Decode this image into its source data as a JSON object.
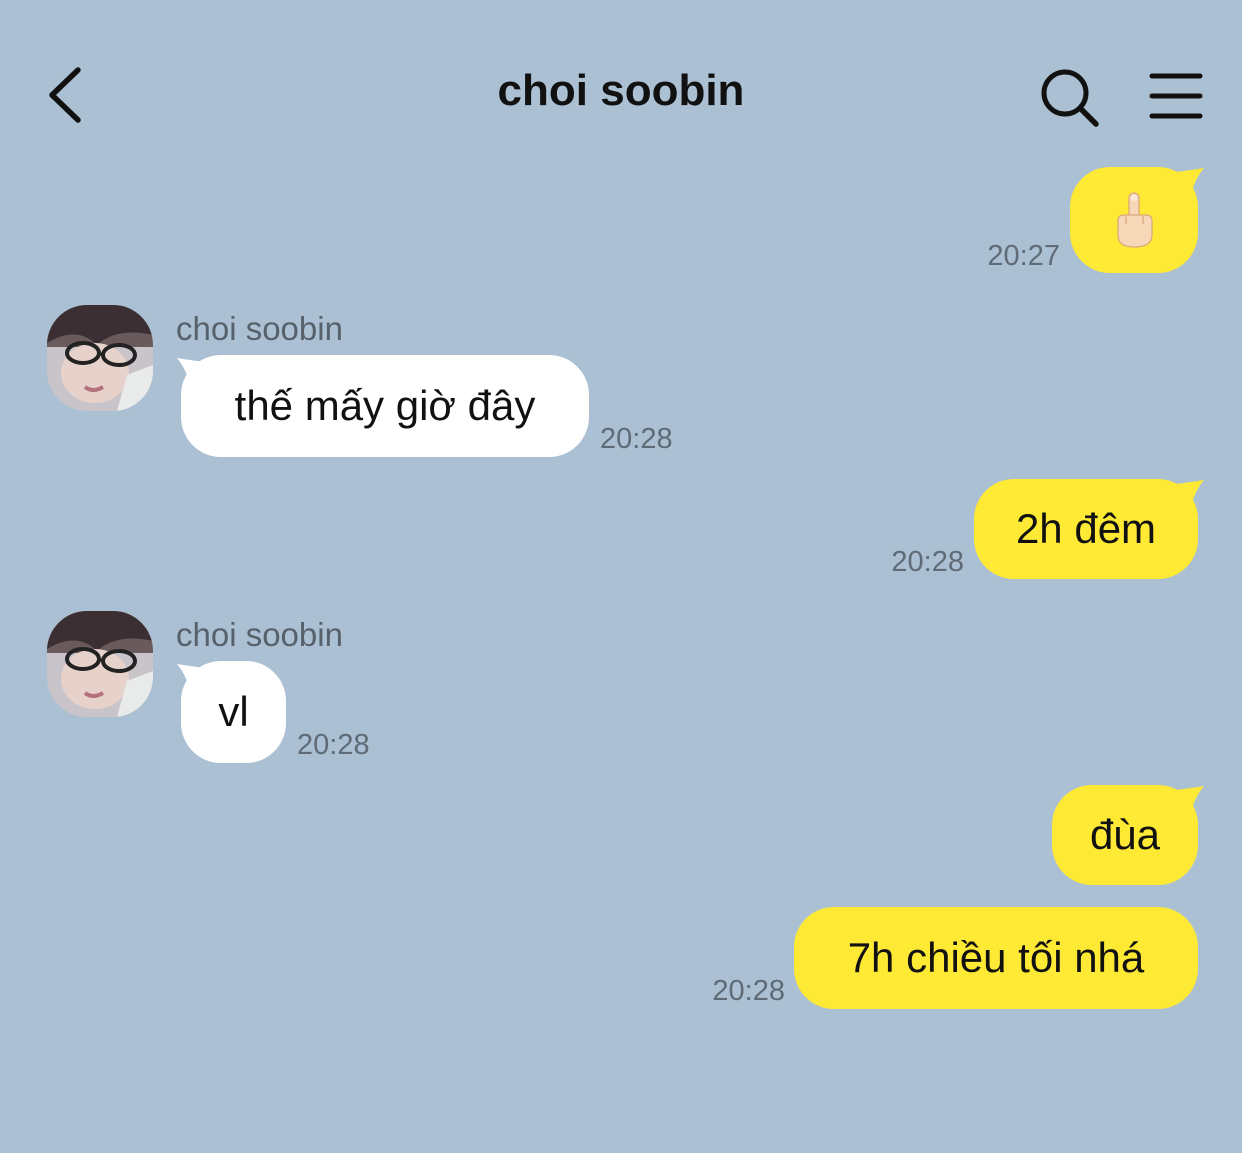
{
  "header": {
    "title": "choi soobin"
  },
  "icons": {
    "back": "chevron-left-icon",
    "search": "search-icon",
    "menu": "hamburger-menu-icon",
    "emoji": "middle-finger-emoji-icon"
  },
  "colors": {
    "background": "#abc1d3",
    "outgoing_bubble": "#fee934",
    "incoming_bubble": "#ffffff",
    "timestamp": "#5f6b76"
  },
  "messages": [
    {
      "direction": "outgoing",
      "type": "emoji",
      "emoji": "🖕",
      "time": "20:27"
    },
    {
      "direction": "incoming",
      "sender": "choi soobin",
      "text": "thế mấy giờ đây",
      "time": "20:28"
    },
    {
      "direction": "outgoing",
      "text": "2h đêm",
      "time": "20:28"
    },
    {
      "direction": "incoming",
      "sender": "choi soobin",
      "text": "vl",
      "time": "20:28"
    },
    {
      "direction": "outgoing",
      "text": "đùa",
      "time": ""
    },
    {
      "direction": "outgoing",
      "text": "7h chiều tối nhá",
      "time": "20:28"
    }
  ]
}
